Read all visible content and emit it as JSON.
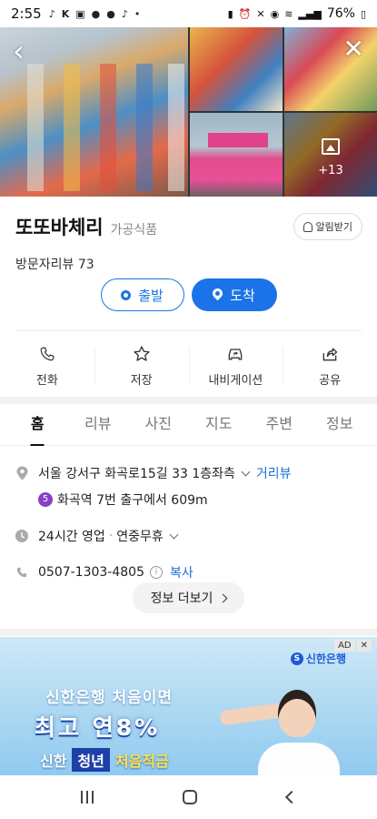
{
  "status_bar": {
    "time": "2:55",
    "battery": "76%"
  },
  "gallery": {
    "more_count": "+13"
  },
  "place": {
    "name": "또또바체리",
    "category": "가공식품",
    "reviews": "방문자리뷰 73",
    "alarm_label": "알림받기"
  },
  "route": {
    "start_label": "출발",
    "arrive_label": "도착"
  },
  "actions": [
    {
      "label": "전화",
      "icon": "phone-icon"
    },
    {
      "label": "저장",
      "icon": "star-icon"
    },
    {
      "label": "내비게이션",
      "icon": "car-icon"
    },
    {
      "label": "공유",
      "icon": "share-icon"
    }
  ],
  "tabs": [
    "홈",
    "리뷰",
    "사진",
    "지도",
    "주변",
    "정보"
  ],
  "info": {
    "address": "서울 강서구 화곡로15길 33 1층좌측",
    "street_view": "거리뷰",
    "subway_line": "5",
    "subway_text": "화곡역 7번 출구에서 609m",
    "hours": "24시간 영업",
    "holiday": "연중무휴",
    "phone": "0507-1303-4805",
    "copy": "복사",
    "more_label": "정보 더보기"
  },
  "ad": {
    "tag": "AD",
    "close": "✕",
    "brand": "신한은행",
    "line1": "신한은행 처음이면",
    "line2": "최고 연8%",
    "line3_a": "신한",
    "line3_b": "청년",
    "line3_c": "처음적금"
  },
  "colors": {
    "accent": "#1a73e8",
    "subway_line5": "#8a3ec8"
  }
}
